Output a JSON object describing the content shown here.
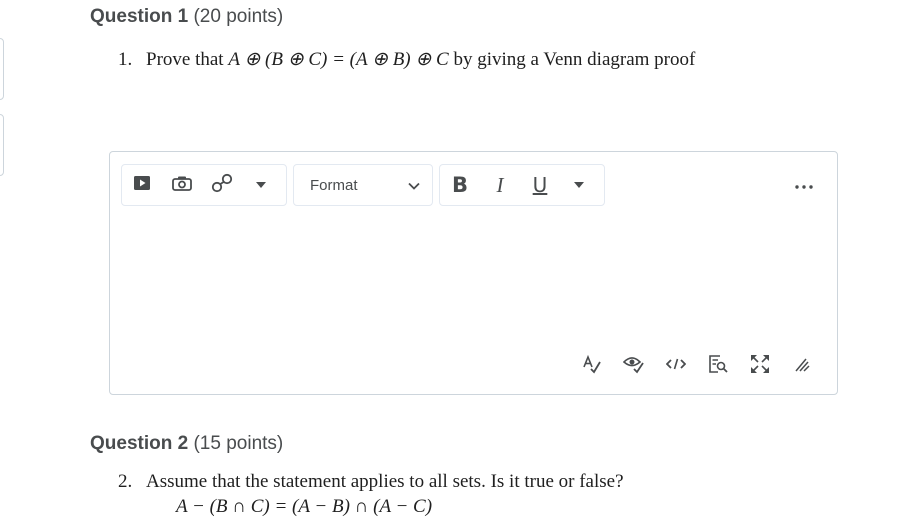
{
  "question1": {
    "title": "Question 1",
    "points": "(20 points)",
    "number": "1.",
    "text_prefix": "Prove that ",
    "formula": "A ⊕ (B ⊕ C) = (A ⊕ B) ⊕ C",
    "text_suffix": " by giving a Venn diagram proof"
  },
  "editor": {
    "toolbar": {
      "insert_stuff_icon": "insert-video-icon",
      "insert_image_icon": "camera-icon",
      "insert_link_icon": "link-icon",
      "more_insert_icon": "caret-down-icon",
      "format_label": "Format",
      "bold_label": "B",
      "italic_label": "I",
      "underline_label": "U",
      "more_label": "..."
    },
    "bottom_toolbar": [
      "spellcheck-icon",
      "accessibility-check-icon",
      "source-code-icon",
      "preview-icon",
      "fullscreen-icon",
      "resize-grip-icon"
    ]
  },
  "question2": {
    "title": "Question 2",
    "points": "(15 points)",
    "number": "2.",
    "text": "Assume that the statement applies to all sets. Is it true or false?",
    "formula": "A − (B ∩ C) = (A − B) ∩ (A − C)"
  },
  "colors": {
    "text": "#494c4e",
    "border": "#cdd5dc",
    "serif_text": "#202020"
  }
}
